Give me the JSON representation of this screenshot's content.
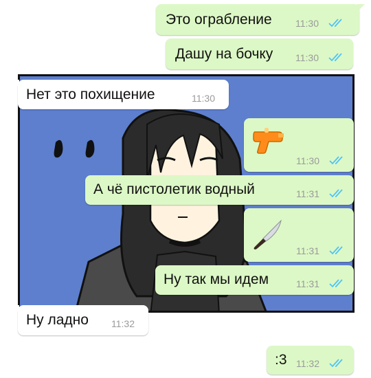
{
  "messages": [
    {
      "id": "m1",
      "dir": "out",
      "text": "Это ограбление",
      "time": "11:30"
    },
    {
      "id": "m2",
      "dir": "out",
      "text": "Дашу на бочку",
      "time": "11:30"
    },
    {
      "id": "m3",
      "dir": "in",
      "text": "Нет это похищение",
      "time": "11:30"
    },
    {
      "id": "m4",
      "dir": "out",
      "emoji": "water-pistol-emoji",
      "time": "11:30"
    },
    {
      "id": "m5",
      "dir": "out",
      "text": "А чё пистолетик водный",
      "time": "11:31"
    },
    {
      "id": "m6",
      "dir": "out",
      "emoji": "knife-emoji",
      "time": "11:31"
    },
    {
      "id": "m7",
      "dir": "out",
      "text": "Ну так мы идем",
      "time": "11:31"
    },
    {
      "id": "m8",
      "dir": "in",
      "text": "Ну ладно",
      "time": "11:32"
    },
    {
      "id": "m9",
      "dir": "out",
      "text": ":3",
      "time": "11:32"
    }
  ],
  "colors": {
    "outgoing": "#dcf8c6",
    "incoming": "#ffffff",
    "read_ticks": "#4fc3f7",
    "comic_bg": "#5d7fce"
  }
}
